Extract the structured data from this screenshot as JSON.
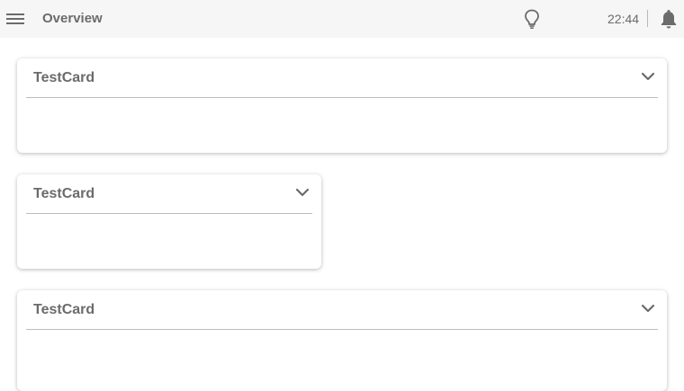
{
  "header": {
    "title": "Overview",
    "time": "22:44",
    "icons": {
      "menu": "hamburger-menu-icon",
      "bulb": "lightbulb-icon",
      "bell": "bell-icon"
    }
  },
  "cards": [
    {
      "title": "TestCard",
      "collapse_icon": "chevron-down-icon"
    },
    {
      "title": "TestCard",
      "collapse_icon": "chevron-down-icon"
    },
    {
      "title": "TestCard",
      "collapse_icon": "chevron-down-icon"
    }
  ],
  "colors": {
    "topbar_bg": "#f6f6f6",
    "text": "#6b6b6b",
    "divider": "#bdbdbd"
  }
}
